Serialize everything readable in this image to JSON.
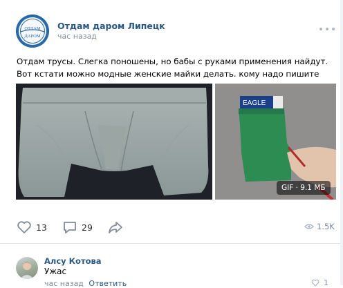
{
  "post": {
    "author": "Отдам даром Липецк",
    "avatar_text_top": "ОТДАМ",
    "avatar_text_bottom": "ДАРОМ",
    "time": "час назад",
    "text": "Отдам трусы. Слегка поношены, но бабы с руками применения найдут. Вот кстати можно модные женские майки делать. кому надо пишите",
    "gif_label": "GIF · 9.1 МБ",
    "gif_brand_text": "EAGLE",
    "likes": "13",
    "comments": "29",
    "views": "1.5K"
  },
  "comment": {
    "author": "Алсу Котова",
    "text": "Ужас",
    "time": "час назад",
    "reply_label": "Ответить",
    "likes": "1"
  },
  "colors": {
    "link": "#2a5885",
    "meta": "#818c99",
    "avatar_bg": "#2a69a8"
  },
  "icons": [
    "more-icon",
    "heart-icon",
    "comment-icon",
    "share-icon",
    "eye-icon"
  ]
}
